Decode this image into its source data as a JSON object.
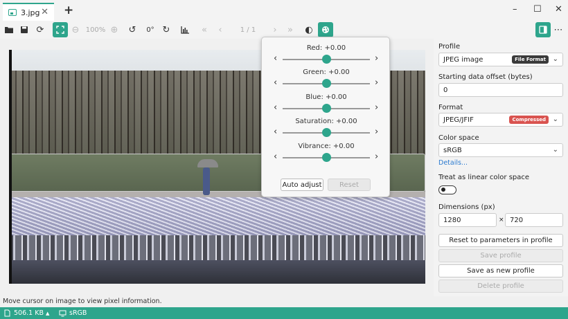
{
  "window": {
    "tab_title": "3.jpg",
    "tab_close": "✕",
    "new_tab": "+",
    "minimize": "–",
    "maximize": "☐",
    "close": "✕"
  },
  "toolbar": {
    "zoom_level": "100%",
    "rotation": "0°",
    "page_indicator": "1 / 1"
  },
  "color_adjust": {
    "sliders": [
      {
        "label": "Red: +0.00",
        "value": 0.0
      },
      {
        "label": "Green: +0.00",
        "value": 0.0
      },
      {
        "label": "Blue: +0.00",
        "value": 0.0
      },
      {
        "label": "Saturation: +0.00",
        "value": 0.0
      },
      {
        "label": "Vibrance: +0.00",
        "value": 0.0
      }
    ],
    "auto_adjust_label": "Auto adjust",
    "reset_label": "Reset"
  },
  "panel": {
    "profile_label": "Profile",
    "profile_value": "JPEG image",
    "profile_badge": "File Format",
    "offset_label": "Starting data offset (bytes)",
    "offset_value": "0",
    "format_label": "Format",
    "format_value": "JPEG/JFIF",
    "format_badge": "Compressed",
    "colorspace_label": "Color space",
    "colorspace_value": "sRGB",
    "details_link": "Details...",
    "linear_label": "Treat as linear color space",
    "linear_toggle": false,
    "dimensions_label": "Dimensions (px)",
    "width": "1280",
    "times": "×",
    "height": "720",
    "reset_params": "Reset to parameters in profile",
    "save_profile": "Save profile",
    "save_new_profile": "Save as new profile",
    "delete_profile": "Delete profile"
  },
  "info_text": "Move cursor on image to view pixel information.",
  "status": {
    "file_size": "506.1 KB",
    "color_space": "sRGB"
  },
  "colors": {
    "accent": "#2ea58c",
    "badge_file_format": "#3a3a3a",
    "badge_compressed": "#d9534f"
  }
}
